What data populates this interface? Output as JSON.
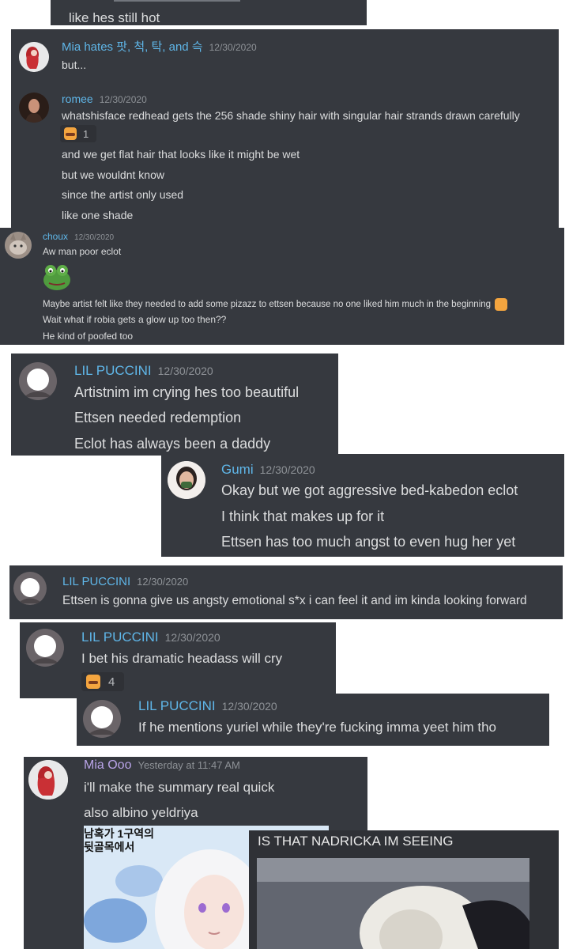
{
  "colors": {
    "panel_bg": "#36393f",
    "name_blue": "#5fb6e8",
    "name_lilac": "#b9a4e8",
    "timestamp": "#8e9297",
    "text": "#dcddde"
  },
  "top_fragment": {
    "text": "like hes still hot"
  },
  "block1": {
    "messages": [
      {
        "author": "Mia hates 팟, 척, 탁, and 슥",
        "time": "12/30/2020",
        "lines": [
          "but..."
        ]
      },
      {
        "author": "romee",
        "time": "12/30/2020",
        "lines": [
          "whatshisface redhead gets the 256 shade shiny hair with singular hair strands drawn carefully",
          "and we get flat hair that looks like it might be wet",
          "but we wouldnt know",
          "since the artist only used",
          "like one shade"
        ],
        "reaction": {
          "emoji": "embarrassed-face-icon",
          "count": "1"
        }
      }
    ]
  },
  "block2": {
    "author": "choux",
    "time": "12/30/2020",
    "lines": [
      "Aw man poor eclot",
      "Maybe artist felt like they needed to add some pizazz to ettsen because no one liked him much in the beginning",
      "Wait what if robia gets a glow up too then??",
      "He kind of poofed too"
    ],
    "sticker": "frog-sticker-icon"
  },
  "block3": {
    "author": "LIL PUCCINI",
    "time": "12/30/2020",
    "lines": [
      "Artistnim im crying hes too beautiful",
      "Ettsen needed redemption",
      "Eclot has always been a daddy"
    ]
  },
  "block4": {
    "author": "Gumi",
    "time": "12/30/2020",
    "lines": [
      "Okay but we got aggressive bed-kabedon eclot",
      "I think that makes up for it",
      "Ettsen has too much angst to even hug her yet"
    ]
  },
  "block5": {
    "author": "LIL PUCCINI",
    "time": "12/30/2020",
    "lines": [
      "Ettsen is gonna give us angsty emotional s*x i can feel it and im kinda looking forward"
    ]
  },
  "block6": {
    "author": "LIL PUCCINI",
    "time": "12/30/2020",
    "lines": [
      "I bet his dramatic headass will cry"
    ],
    "reaction": {
      "emoji": "embarrassed-face-icon",
      "count": "4"
    }
  },
  "block7": {
    "author": "LIL PUCCINI",
    "time": "12/30/2020",
    "lines": [
      "If he mentions yuriel while they're fucking imma yeet him tho"
    ]
  },
  "block8": {
    "author": "Mia Ooo",
    "time": "Yesterday at 11:47 AM",
    "lines": [
      "i'll make the summary real quick",
      "also albino yeldriya"
    ],
    "image1_korean": "남혹가 1구역의\n뒷골목에서"
  },
  "block9": {
    "caption": "IS THAT NADRICKA IM SEEING"
  }
}
